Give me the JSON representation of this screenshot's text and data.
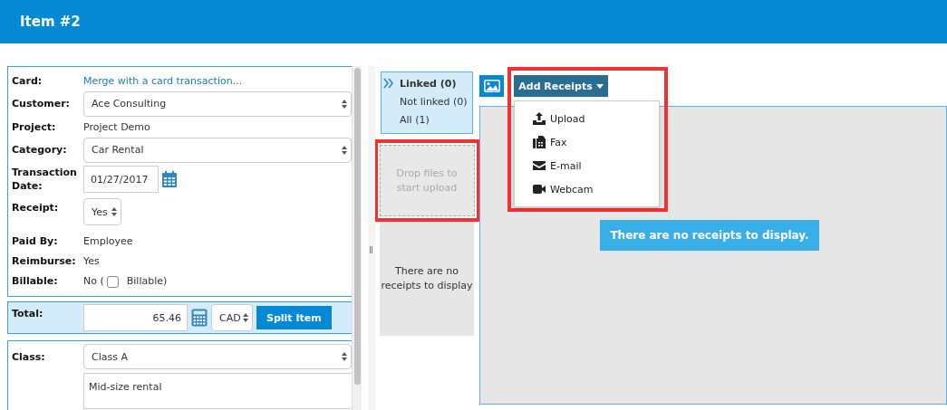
{
  "header": {
    "title": "Item #2"
  },
  "form": {
    "fields": [
      {
        "label": "Card:",
        "kind": "link",
        "value": "Merge with a card transaction..."
      },
      {
        "label": "Customer:",
        "kind": "select",
        "value": "Ace Consulting"
      },
      {
        "label": "Project:",
        "kind": "text",
        "value": "Project Demo"
      },
      {
        "label": "Category:",
        "kind": "select",
        "value": "Car Rental"
      },
      {
        "label": "Transaction Date:",
        "kind": "date",
        "value": "01/27/2017"
      },
      {
        "label": "Receipt:",
        "kind": "small_select",
        "value": "Yes"
      },
      {
        "label": "Paid By:",
        "kind": "text",
        "value": "Employee"
      },
      {
        "label": "Reimburse:",
        "kind": "text",
        "value": "Yes"
      },
      {
        "label": "Billable:",
        "kind": "checkbox",
        "value": "No (",
        "checkbox_label": "Billable)",
        "checked": false
      }
    ],
    "total": {
      "label": "Total:",
      "amount": "65.46",
      "currency": "CAD",
      "split_button": "Split Item"
    },
    "class": {
      "label": "Class:",
      "value": "Class A",
      "description": "Mid-size rental"
    }
  },
  "filters": [
    {
      "label": "Linked (0)",
      "selected": true
    },
    {
      "label": "Not linked (0)",
      "selected": false
    },
    {
      "label": "All (1)",
      "selected": false
    }
  ],
  "drop_zone": {
    "text": "Drop files to start upload",
    "highlighted": true
  },
  "linked_empty": "There are no receipts to display",
  "add_receipts": {
    "label": "Add Receipts",
    "highlighted": true,
    "menu": [
      {
        "label": "Upload",
        "kind": "upload"
      },
      {
        "label": "Fax",
        "kind": "fax"
      },
      {
        "label": "E-mail",
        "kind": "email"
      },
      {
        "label": "Webcam",
        "kind": "webcam"
      }
    ]
  },
  "receipts_empty": "There are no receipts to display."
}
